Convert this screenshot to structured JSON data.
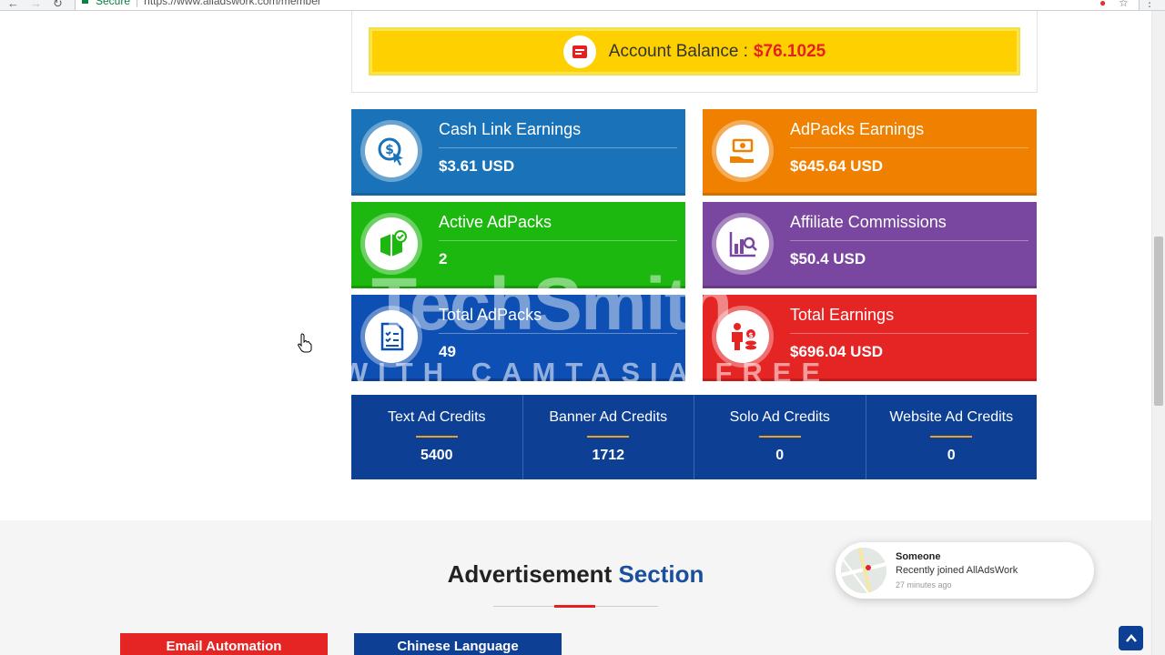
{
  "browser": {
    "secure_label": "Secure",
    "url": "https://www.alladswork.com/member"
  },
  "balance": {
    "label": "Account Balance :",
    "amount": "$76.1025"
  },
  "cards": [
    {
      "label": "Cash Link Earnings",
      "value": "$3.61 USD",
      "color": "#1a73b8",
      "accent": "#1565a3",
      "icon": "dollar-cursor-icon"
    },
    {
      "label": "AdPacks Earnings",
      "value": "$645.64 USD",
      "color": "#f08000",
      "accent": "#d46f00",
      "icon": "money-hand-icon"
    },
    {
      "label": "Active AdPacks",
      "value": "2",
      "color": "#1db80f",
      "accent": "#17990b",
      "icon": "package-check-icon"
    },
    {
      "label": "Affiliate Commissions",
      "value": "$50.4 USD",
      "color": "#7a47a0",
      "accent": "#663a88",
      "icon": "chart-search-icon"
    },
    {
      "label": "Total AdPacks",
      "value": "49",
      "color": "#0e4fb4",
      "accent": "#0a3f93",
      "icon": "document-list-icon"
    },
    {
      "label": "Total Earnings",
      "value": "$696.04 USD",
      "color": "#e52424",
      "accent": "#c51b1b",
      "icon": "person-coins-icon"
    }
  ],
  "credits": [
    {
      "label": "Text Ad Credits",
      "value": "5400"
    },
    {
      "label": "Banner Ad Credits",
      "value": "1712"
    },
    {
      "label": "Solo Ad Credits",
      "value": "0"
    },
    {
      "label": "Website Ad Credits",
      "value": "0"
    }
  ],
  "ad_section": {
    "title_main": "Advertisement",
    "title_accent": "Section",
    "buttons": [
      {
        "label": "Email Automation",
        "color": "#e52424"
      },
      {
        "label": "Chinese Language",
        "color": "#0d3f94"
      }
    ]
  },
  "toast": {
    "who": "Someone",
    "message": "Recently joined AllAdsWork",
    "time": "27 minutes ago"
  },
  "watermark": {
    "brand": "TechSmith",
    "trial": "MADE WITH CAMTASIA FREE TRIAL"
  }
}
